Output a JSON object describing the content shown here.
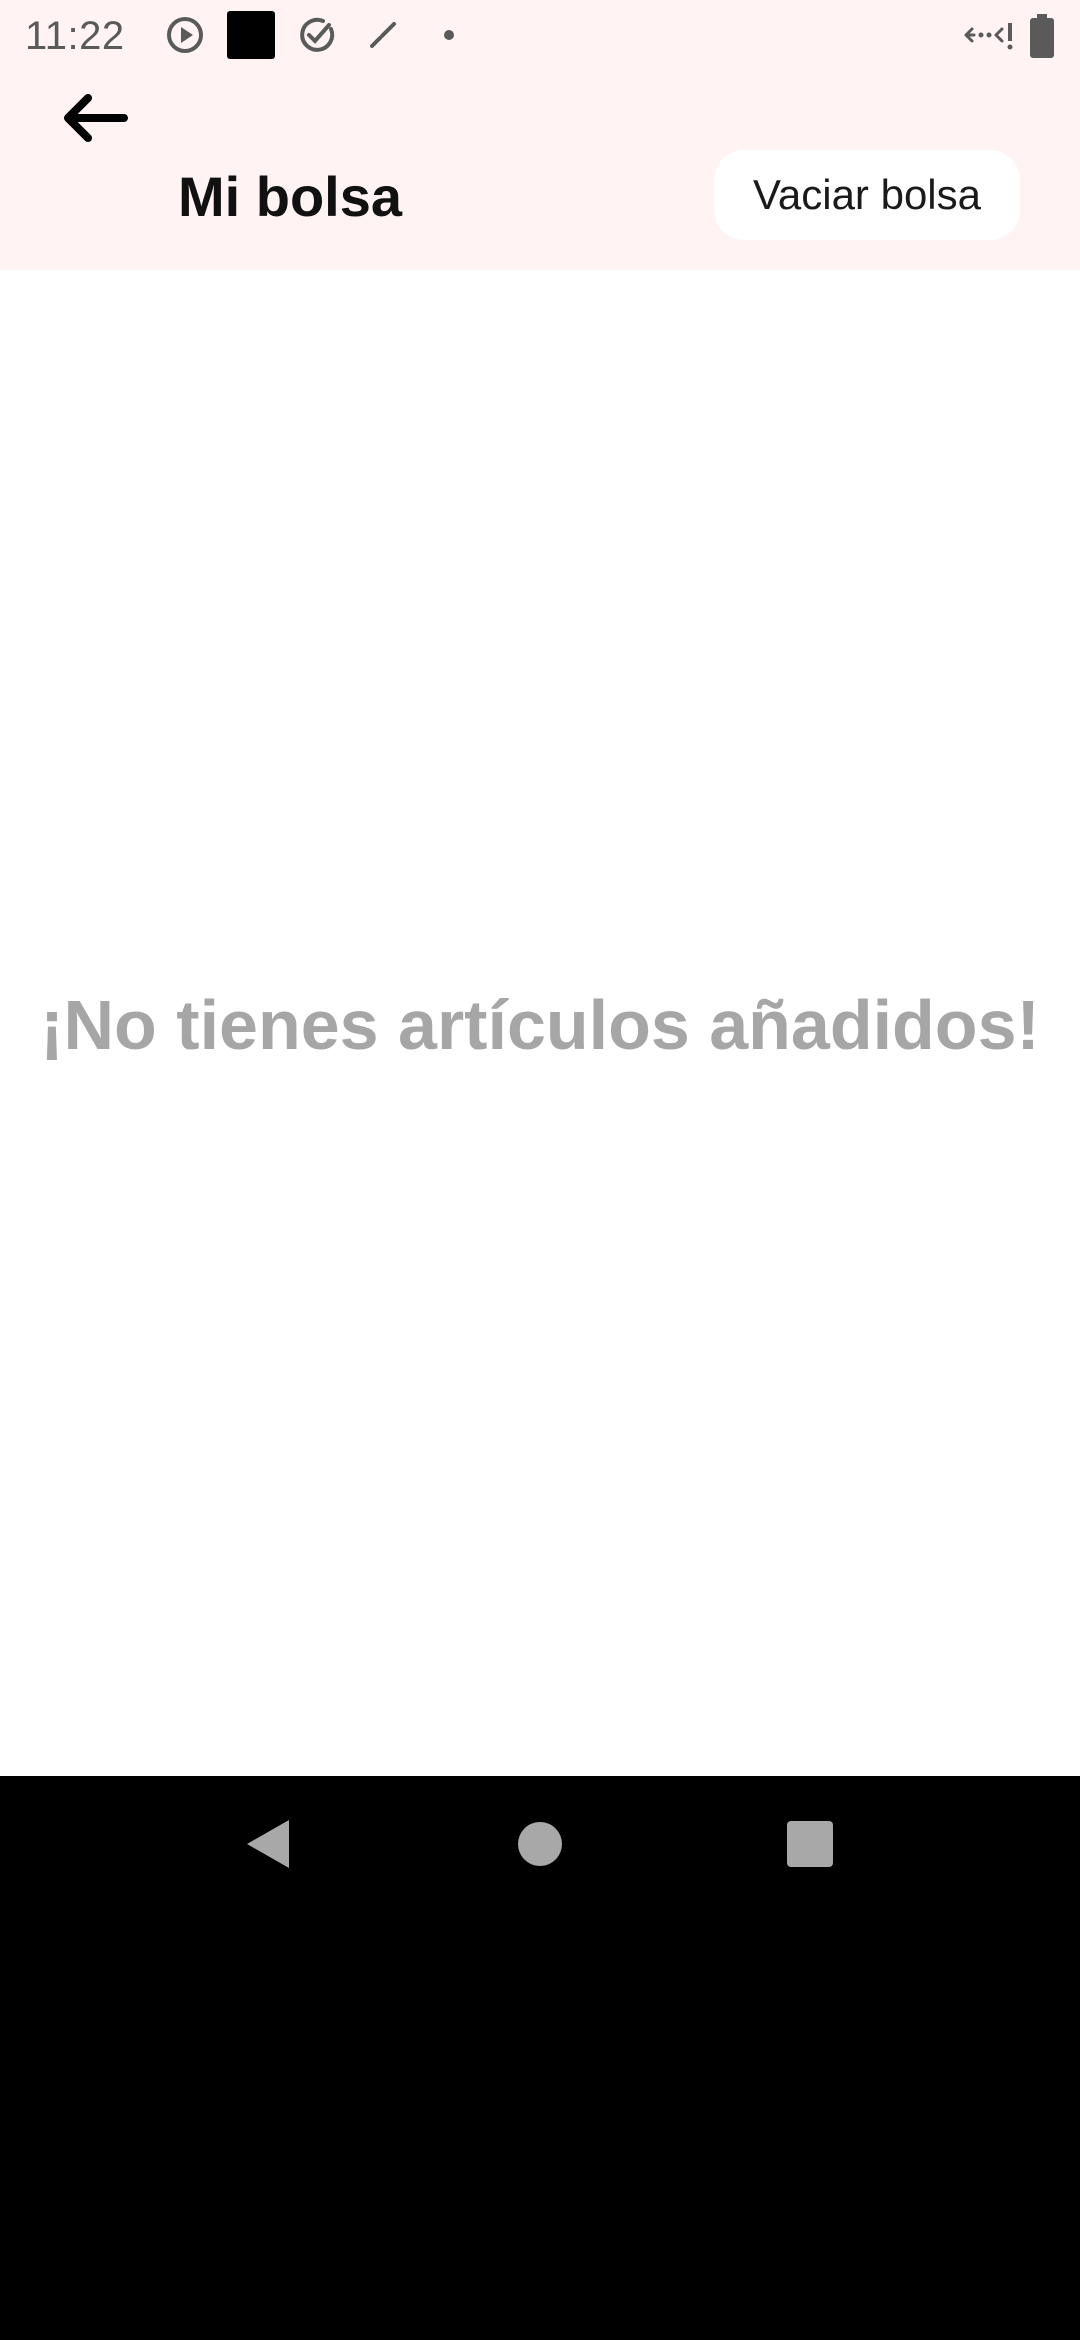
{
  "status_bar": {
    "time": "11:22",
    "icons": [
      "play-circle-icon",
      "black-square-icon",
      "check-circle-icon",
      "brush-icon",
      "dot-icon",
      "data-arrows-icon",
      "battery-icon"
    ]
  },
  "app_bar": {
    "back_icon": "arrow-left-icon",
    "title": "Mi bolsa",
    "clear_button": "Vaciar bolsa",
    "background": "#fff3f3"
  },
  "content": {
    "empty_message": "¡No tienes artículos añadidos!",
    "empty_color": "#a6a6a6"
  },
  "nav_bar": {
    "buttons": [
      "back-triangle-icon",
      "home-circle-icon",
      "recents-square-icon"
    ]
  }
}
